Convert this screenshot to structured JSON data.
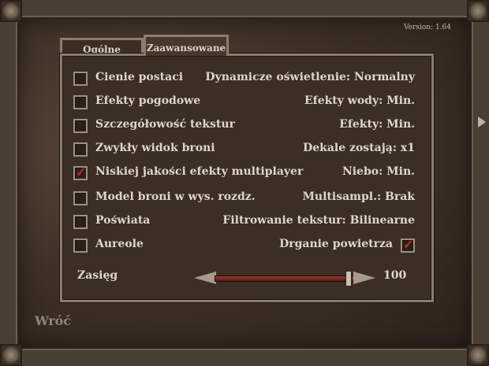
{
  "version": "Version: 1.64",
  "tabs": [
    {
      "label": "Ogólne",
      "active": false
    },
    {
      "label": "Zaawansowane",
      "active": true
    }
  ],
  "options_left": [
    {
      "label": "Cienie postaci",
      "checked": false
    },
    {
      "label": "Efekty pogodowe",
      "checked": false
    },
    {
      "label": "Szczegółowość tekstur",
      "checked": false
    },
    {
      "label": "Zwykły widok broni",
      "checked": false
    },
    {
      "label": "Niskiej jakości efekty multiplayer",
      "checked": true
    },
    {
      "label": "Model broni w wys. rozdz.",
      "checked": false
    },
    {
      "label": "Poświata",
      "checked": false
    },
    {
      "label": "Aureole",
      "checked": false
    }
  ],
  "options_right": [
    {
      "label": "Dynamicze oświetlenie: Normalny"
    },
    {
      "label": "Efekty wody: Min."
    },
    {
      "label": "Efekty: Min."
    },
    {
      "label": "Dekale zostają: x1"
    },
    {
      "label": "Niebo: Min."
    },
    {
      "label": "Multisampl.: Brak"
    },
    {
      "label": "Filtrowanie tekstur: Bilinearne"
    },
    {
      "label": "Drganie powietrza",
      "checked": true
    }
  ],
  "slider": {
    "label": "Zasięg",
    "value": "100",
    "fraction": 0.95
  },
  "back_label": "Wróć",
  "colors": {
    "check": "#c02a22",
    "text": "#e0d6c7",
    "accent_track": "#9b3a30"
  }
}
